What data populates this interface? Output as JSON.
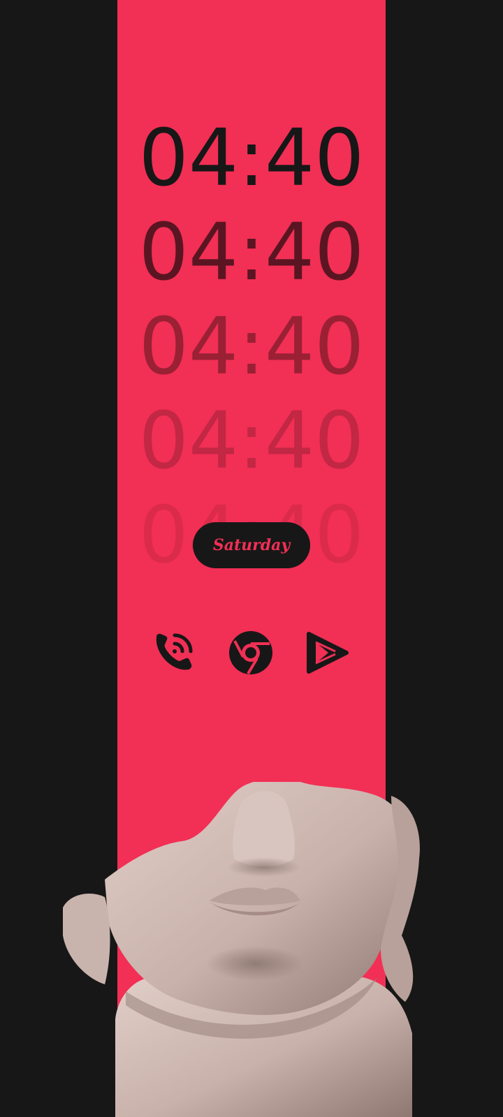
{
  "lock_screen": {
    "clock_repeats": [
      "04:40",
      "04:40",
      "04:40",
      "04:40",
      "04:40"
    ],
    "day": "Saturday"
  },
  "dock": {
    "apps": [
      {
        "name": "Phone",
        "icon": "phone-icon"
      },
      {
        "name": "Chrome",
        "icon": "chrome-icon"
      },
      {
        "name": "Play Store",
        "icon": "play-store-icon"
      }
    ]
  },
  "colors": {
    "background": "#171717",
    "accent_band": "#f22f55",
    "clock_primary": "#171717",
    "pill_text": "#f22f55",
    "statue_marble": "#d2bdb6"
  }
}
